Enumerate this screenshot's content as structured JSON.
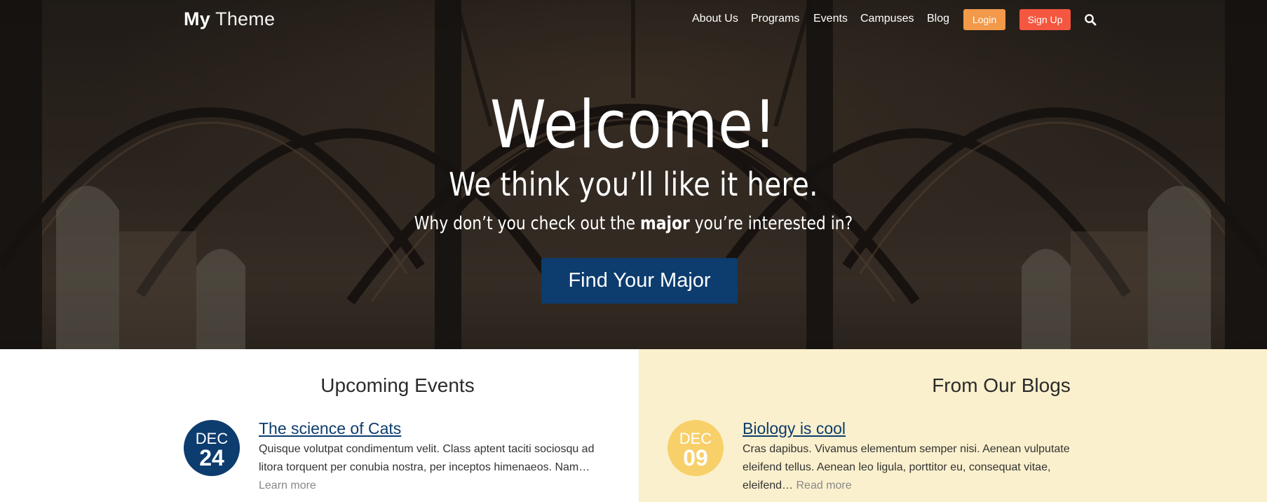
{
  "header": {
    "logo_bold": "My",
    "logo_light": "Theme",
    "nav": [
      "About Us",
      "Programs",
      "Events",
      "Campuses",
      "Blog"
    ],
    "login_label": "Login",
    "signup_label": "Sign Up",
    "search_icon": "search-icon"
  },
  "hero": {
    "headline": "Welcome!",
    "tagline": "We think you’ll like it here.",
    "subline_before": "Why don’t you check out the ",
    "subline_bold": "major",
    "subline_after": " you’re interested in?",
    "cta_label": "Find Your Major"
  },
  "events": {
    "title": "Upcoming Events",
    "items": [
      {
        "month": "DEC",
        "day": "24",
        "title": "The science of Cats",
        "body": "Quisque volutpat condimentum velit. Class aptent taciti sociosqu ad litora torquent per conubia nostra, per inceptos himenaeos. Nam…",
        "link": "Learn more"
      }
    ]
  },
  "blogs": {
    "title": "From Our Blogs",
    "items": [
      {
        "month": "DEC",
        "day": "09",
        "title": "Biology is cool",
        "body": "Cras dapibus. Vivamus elementum semper nisi. Aenean vulputate eleifend tellus. Aenean leo ligula, porttitor eu, consequat vitae, eleifend…",
        "link": "Read more"
      }
    ]
  },
  "colors": {
    "primary": "#0d3c6e",
    "login": "#f2994a",
    "signup": "#f4563f",
    "blog_bg": "#fbf0cd",
    "blog_badge": "#f7d06a"
  }
}
